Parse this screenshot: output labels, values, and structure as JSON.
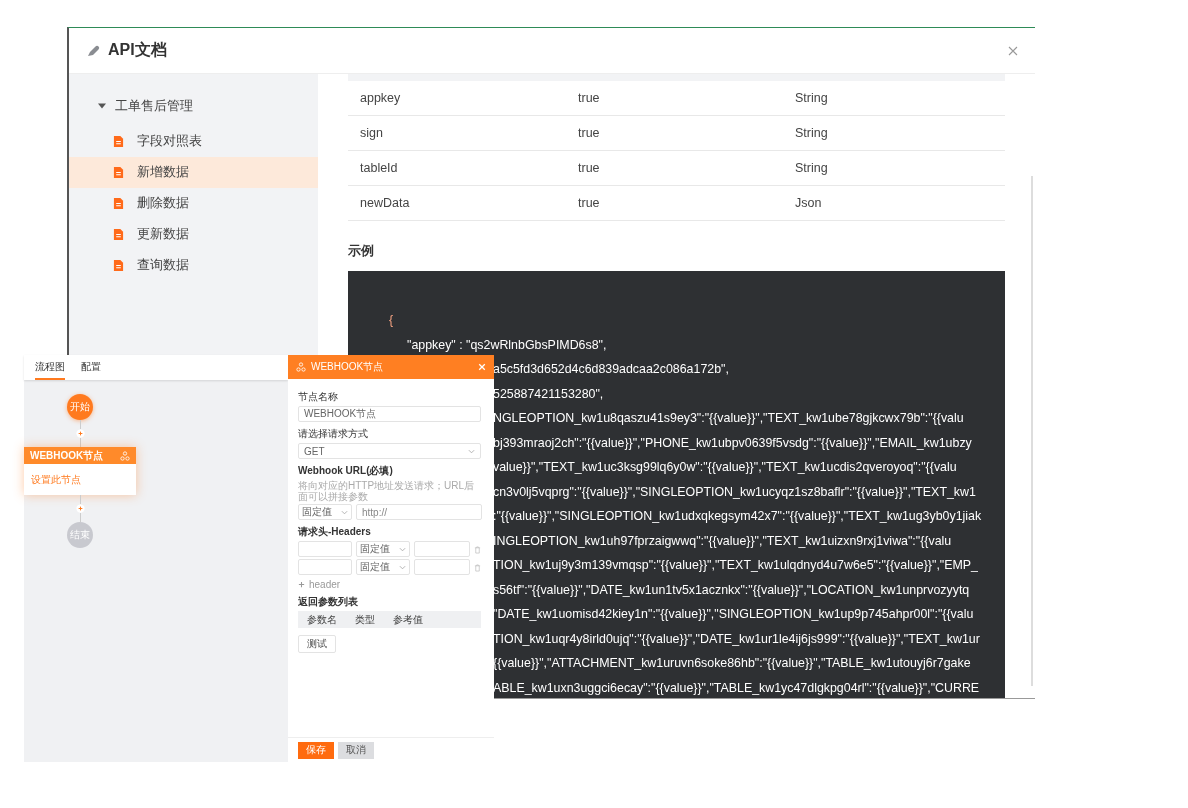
{
  "window": {
    "title": "API文档"
  },
  "sidebar": {
    "group": {
      "label": "工单售后管理",
      "expanded": true,
      "children": [
        {
          "label": "字段对照表",
          "selected": false
        },
        {
          "label": "新增数据",
          "selected": true
        },
        {
          "label": "删除数据",
          "selected": false
        },
        {
          "label": "更新数据",
          "selected": false
        },
        {
          "label": "查询数据",
          "selected": false
        }
      ]
    }
  },
  "params_table": {
    "rows": [
      {
        "name": "appkey",
        "required": "true",
        "type": "String"
      },
      {
        "name": "sign",
        "required": "true",
        "type": "String"
      },
      {
        "name": "tableId",
        "required": "true",
        "type": "String"
      },
      {
        "name": "newData",
        "required": "true",
        "type": "Json"
      }
    ]
  },
  "example": {
    "title": "示例",
    "lines": [
      {
        "kind": "brace",
        "text": "{"
      },
      {
        "kind": "entry",
        "text": "\"appkey\" : \"qs2wRlnbGbsPIMD6s8\","
      },
      {
        "kind": "covered",
        "text": "a5c5fd3d652d4c6d839adcaa2c086a172b\","
      },
      {
        "kind": "covered",
        "text": "525887421153280\","
      },
      {
        "kind": "covered",
        "text": "NGLEOPTION_kw1u8qaszu41s9ey3\":\"{{value}}\",\"TEXT_kw1ube78gjkcwx79b\":\"{{valu"
      },
      {
        "kind": "covered",
        "text": "bj393mraoj2ch\":\"{{value}}\",\"PHONE_kw1ubpv0639f5vsdg\":\"{{value}}\",\"EMAIL_kw1ubzy"
      },
      {
        "kind": "covered",
        "text": "value}}\",\"TEXT_kw1uc3ksg99lq6y0w\":\"{{value}}\",\"TEXT_kw1ucdis2qveroyoq\":\"{{valu"
      },
      {
        "kind": "covered",
        "text": "cn3v0lj5vqprg\":\"{{value}}\",\"SINGLEOPTION_kw1ucyqz1sz8baflr\":\"{{value}}\",\"TEXT_kw1"
      },
      {
        "kind": "covered",
        "text": ":\"{{value}}\",\"SINGLEOPTION_kw1udxqkegsym42x7\":\"{{value}}\",\"TEXT_kw1ug3yb0y1jiak"
      },
      {
        "kind": "covered",
        "text": "INGLEOPTION_kw1uh97fprzaigwwq\":\"{{value}}\",\"TEXT_kw1uizxn9rxj1viwa\":\"{{valu"
      },
      {
        "kind": "covered",
        "text": "TION_kw1uj9y3m139vmqsp\":\"{{value}}\",\"TEXT_kw1ulqdnyd4u7w6e5\":\"{{value}}\",\"EMP_"
      },
      {
        "kind": "covered",
        "text": "s56tf\":\"{{value}}\",\"DATE_kw1un1tv5x1acznkx\":\"{{value}}\",\"LOCATION_kw1unprvozyytq"
      },
      {
        "kind": "covered",
        "text": "\"DATE_kw1uomisd42kiey1n\":\"{{value}}\",\"SINGLEOPTION_kw1up9p745ahpr00l\":\"{{valu"
      },
      {
        "kind": "covered",
        "text": "TION_kw1uqr4y8irld0ujq\":\"{{value}}\",\"DATE_kw1ur1le4ij6js999\":\"{{value}}\",\"TEXT_kw1ur"
      },
      {
        "kind": "covered",
        "text": "{{value}}\",\"ATTACHMENT_kw1uruvn6soke86hb\":\"{{value}}\",\"TABLE_kw1utouyj6r7gake"
      },
      {
        "kind": "covered",
        "text": "ABLE_kw1uxn3uggci6ecay\":\"{{value}}\",\"TABLE_kw1yc47dlgkpg04rl\":\"{{value}}\",\"CURRE"
      }
    ]
  },
  "flow_editor": {
    "tabs": [
      {
        "label": "流程图",
        "selected": true
      },
      {
        "label": "配置",
        "selected": false
      }
    ],
    "nodes": [
      {
        "kind": "start",
        "label": "开始"
      },
      {
        "kind": "action",
        "title": "WEBHOOK节点",
        "subtitle": "设置此节点"
      },
      {
        "kind": "end",
        "label": "结束"
      }
    ],
    "panel": {
      "title": "WEBHOOK节点",
      "node_name": {
        "label": "节点名称",
        "value": "WEBHOOK节点"
      },
      "method": {
        "label": "请选择请求方式",
        "value": "GET"
      },
      "url": {
        "label": "Webhook URL(必填)",
        "hint": "将向对应的HTTP地址发送请求；URL后面可以拼接参数",
        "mode": "固定值",
        "placeholder": "http://"
      },
      "headers": {
        "label": "请求头-Headers",
        "rows": [
          {
            "mode": "固定值"
          },
          {
            "mode": "固定值"
          }
        ],
        "add_label": "header"
      },
      "returns": {
        "label": "返回参数列表",
        "columns": [
          "参数名",
          "类型",
          "参考值"
        ]
      },
      "test_button": "测试",
      "save_button": "保存",
      "cancel_button": "取消"
    }
  }
}
